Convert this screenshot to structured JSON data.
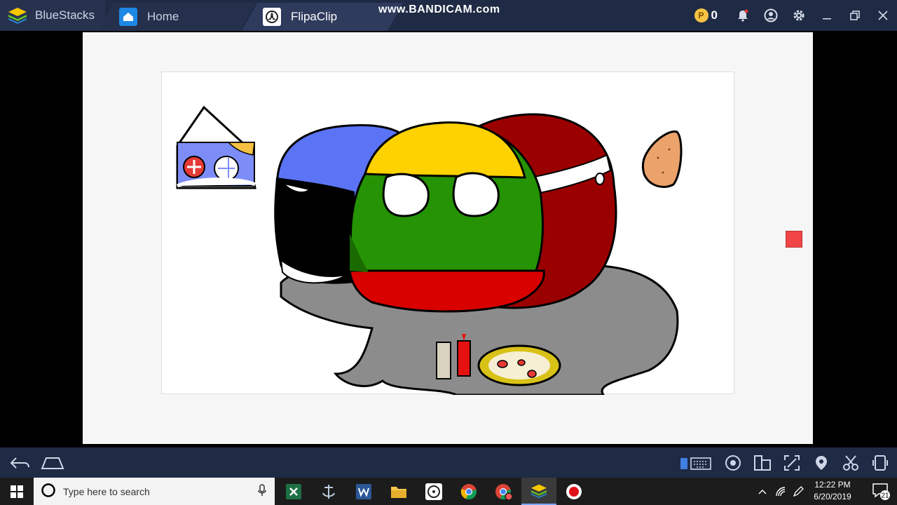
{
  "app": {
    "brand": "BlueStacks"
  },
  "tabs": [
    {
      "label": "Home"
    },
    {
      "label": "FlipaClip"
    }
  ],
  "watermark": "www.BANDICAM.com",
  "coins": {
    "value": "0"
  },
  "taskbar": {
    "search_placeholder": "Type here to search",
    "time": "12:22 PM",
    "date": "6/20/2019",
    "notification_count": "21"
  },
  "colors": {
    "accent": "#1f2a44",
    "lithuania_yellow": "#fdd200",
    "lithuania_green": "#259303",
    "lithuania_red": "#d90000",
    "latvia_red": "#9b0000"
  }
}
